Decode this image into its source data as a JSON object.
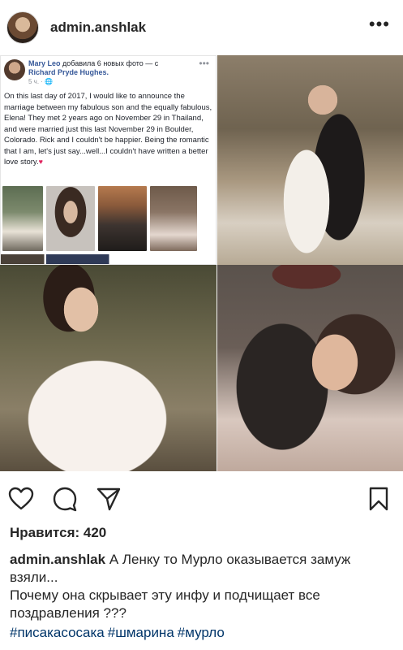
{
  "header": {
    "username": "admin.anshlak",
    "avatar_icon": "avatar",
    "more_icon": "more-dots-icon",
    "more_label": "•••"
  },
  "fb_post": {
    "author": "Mary Leo",
    "added_text": "добавила 6 новых фото — с",
    "tagged": "Richard Pryde Hughes.",
    "time": "5 ч. · 🌐",
    "more_label": "•••",
    "body": "On this last day of 2017, I would like to announce the marriage between my fabulous son and the equally fabulous, Elena! They met 2 years ago on November 29 in Thailand, and were married just this last November 29 in Boulder, Colorado. Rick and I couldn't be happier. Being the romantic that I am, let's just say...well...I couldn't have written a better love story.",
    "heart": "♥"
  },
  "actions": {
    "like_icon": "heart-icon",
    "comment_icon": "comment-icon",
    "share_icon": "share-icon",
    "save_icon": "bookmark-icon"
  },
  "likes": {
    "text": "Нравится: 420"
  },
  "caption": {
    "username": "admin.anshlak",
    "text_line1": "А Ленку то Мурло оказывается замуж взяли...",
    "text_line2": "Почему она скрывает эту инфу и подчищает все поздравления ???"
  },
  "hashtags": [
    "#писакасосака",
    "#шмарина",
    "#мурло"
  ],
  "colors": {
    "text": "#262626",
    "hashtag": "#003569",
    "fb_link": "#365899"
  }
}
